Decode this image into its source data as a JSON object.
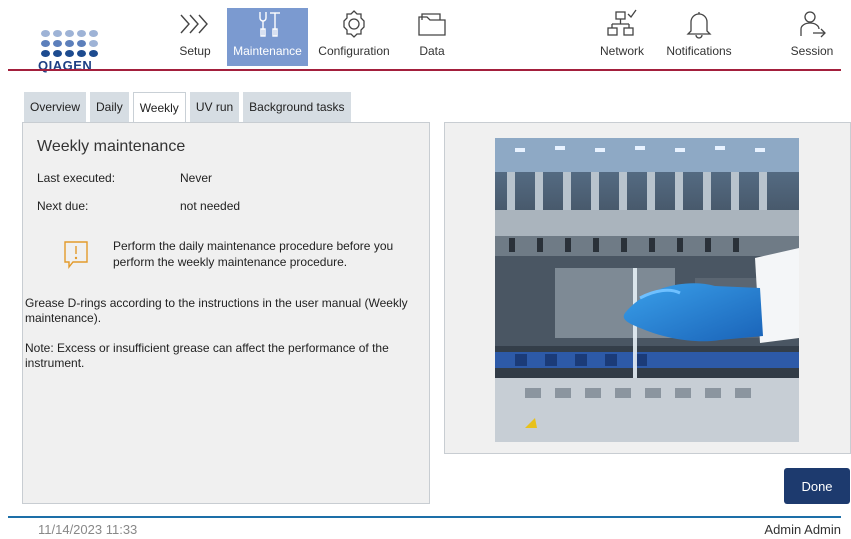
{
  "brand": {
    "logo_text": "QIAGEN",
    "accent_color": "#a31f3c",
    "primary_color": "#1d3a6e",
    "nav_active_color": "#7b9ad0"
  },
  "nav": {
    "setup": "Setup",
    "maintenance": "Maintenance",
    "configuration": "Configuration",
    "data": "Data",
    "network": "Network",
    "notifications": "Notifications",
    "session": "Session"
  },
  "tabs": {
    "overview": "Overview",
    "daily": "Daily",
    "weekly": "Weekly",
    "uv_run": "UV run",
    "background_tasks": "Background tasks"
  },
  "panel": {
    "title": "Weekly maintenance",
    "last_executed_label": "Last executed:",
    "last_executed_value": "Never",
    "next_due_label": "Next due:",
    "next_due_value": "not needed",
    "warning": "Perform the daily maintenance procedure before you perform the weekly maintenance procedure.",
    "instruction": "Grease D-rings according to the instructions in the user manual (Weekly maintenance).",
    "note": "Note: Excess or insufficient grease can affect the performance of the instrument."
  },
  "done_label": "Done",
  "footer": {
    "datetime": "11/14/2023 11:33",
    "user": "Admin Admin"
  },
  "icons": [
    "setup-icon",
    "maintenance-icon",
    "configuration-icon",
    "data-icon",
    "network-icon",
    "notifications-icon",
    "session-icon",
    "warning-icon"
  ]
}
